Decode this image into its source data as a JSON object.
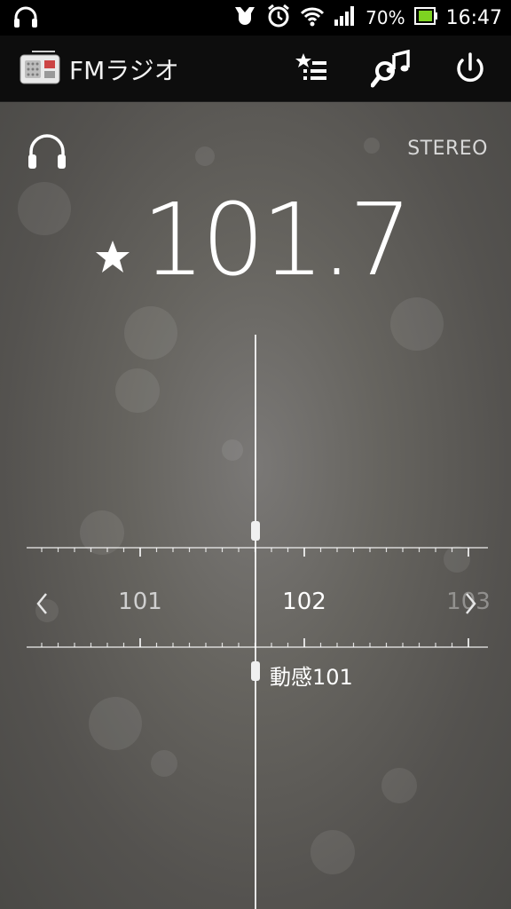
{
  "status_bar": {
    "battery_percent": "70%",
    "time": "16:47",
    "icons": [
      "headphones-icon",
      "usb-icon",
      "alarm-icon",
      "wifi-icon",
      "signal-icon",
      "battery-icon"
    ]
  },
  "action_bar": {
    "title": "FMラジオ",
    "icons": [
      "radio-app-icon",
      "favorites-list-icon",
      "search-music-icon",
      "power-icon"
    ]
  },
  "player": {
    "output_icon": "headphones-icon",
    "audio_mode": "STEREO",
    "favorite_icon": "star-icon",
    "frequency": "101.7"
  },
  "tuner": {
    "labels": [
      "101",
      "102",
      "103"
    ],
    "current_position": 101.7,
    "station_name": "動感101",
    "prev_icon": "chevron-left-icon",
    "next_icon": "chevron-right-icon"
  },
  "colors": {
    "background_top": "#7a7876",
    "background_edge": "#4a4946",
    "text": "#ffffff",
    "bar": "#0d0d0d"
  }
}
